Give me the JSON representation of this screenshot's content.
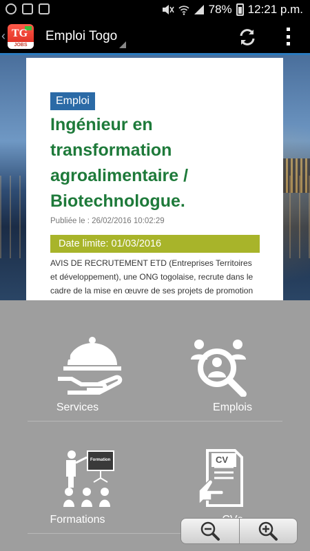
{
  "status": {
    "battery": "78%",
    "time": "12:21 p.m."
  },
  "actionbar": {
    "title": "Emploi Togo",
    "logo_text": "TG",
    "logo_sub": "JOBS"
  },
  "post": {
    "category": "Emploi",
    "title": "Ingénieur en transformation agroalimentaire / Biotechnologue.",
    "published": "Publiée le : 26/02/2016 10:02:29",
    "deadline": "Date limite: 01/03/2016",
    "excerpt": "AVIS DE RECRUTEMENT ETD (Entreprises Territoires et développement), une ONG togolaise, recrute dans le cadre de la mise en œuvre de ses projets de promotion d’entreprises ESOP (Entreprises de Services […]"
  },
  "menu": {
    "services": "Services",
    "emplois": "Emplois",
    "formations": "Formations",
    "cvs": "CVs",
    "formation_board": "Formation"
  },
  "colors": {
    "accent": "#2b7bbf",
    "tag_bg": "#2b6aa6",
    "title_green": "#1e7a3a",
    "deadline_bg": "#a8b42a",
    "grid_bg": "#9e9e9e"
  }
}
